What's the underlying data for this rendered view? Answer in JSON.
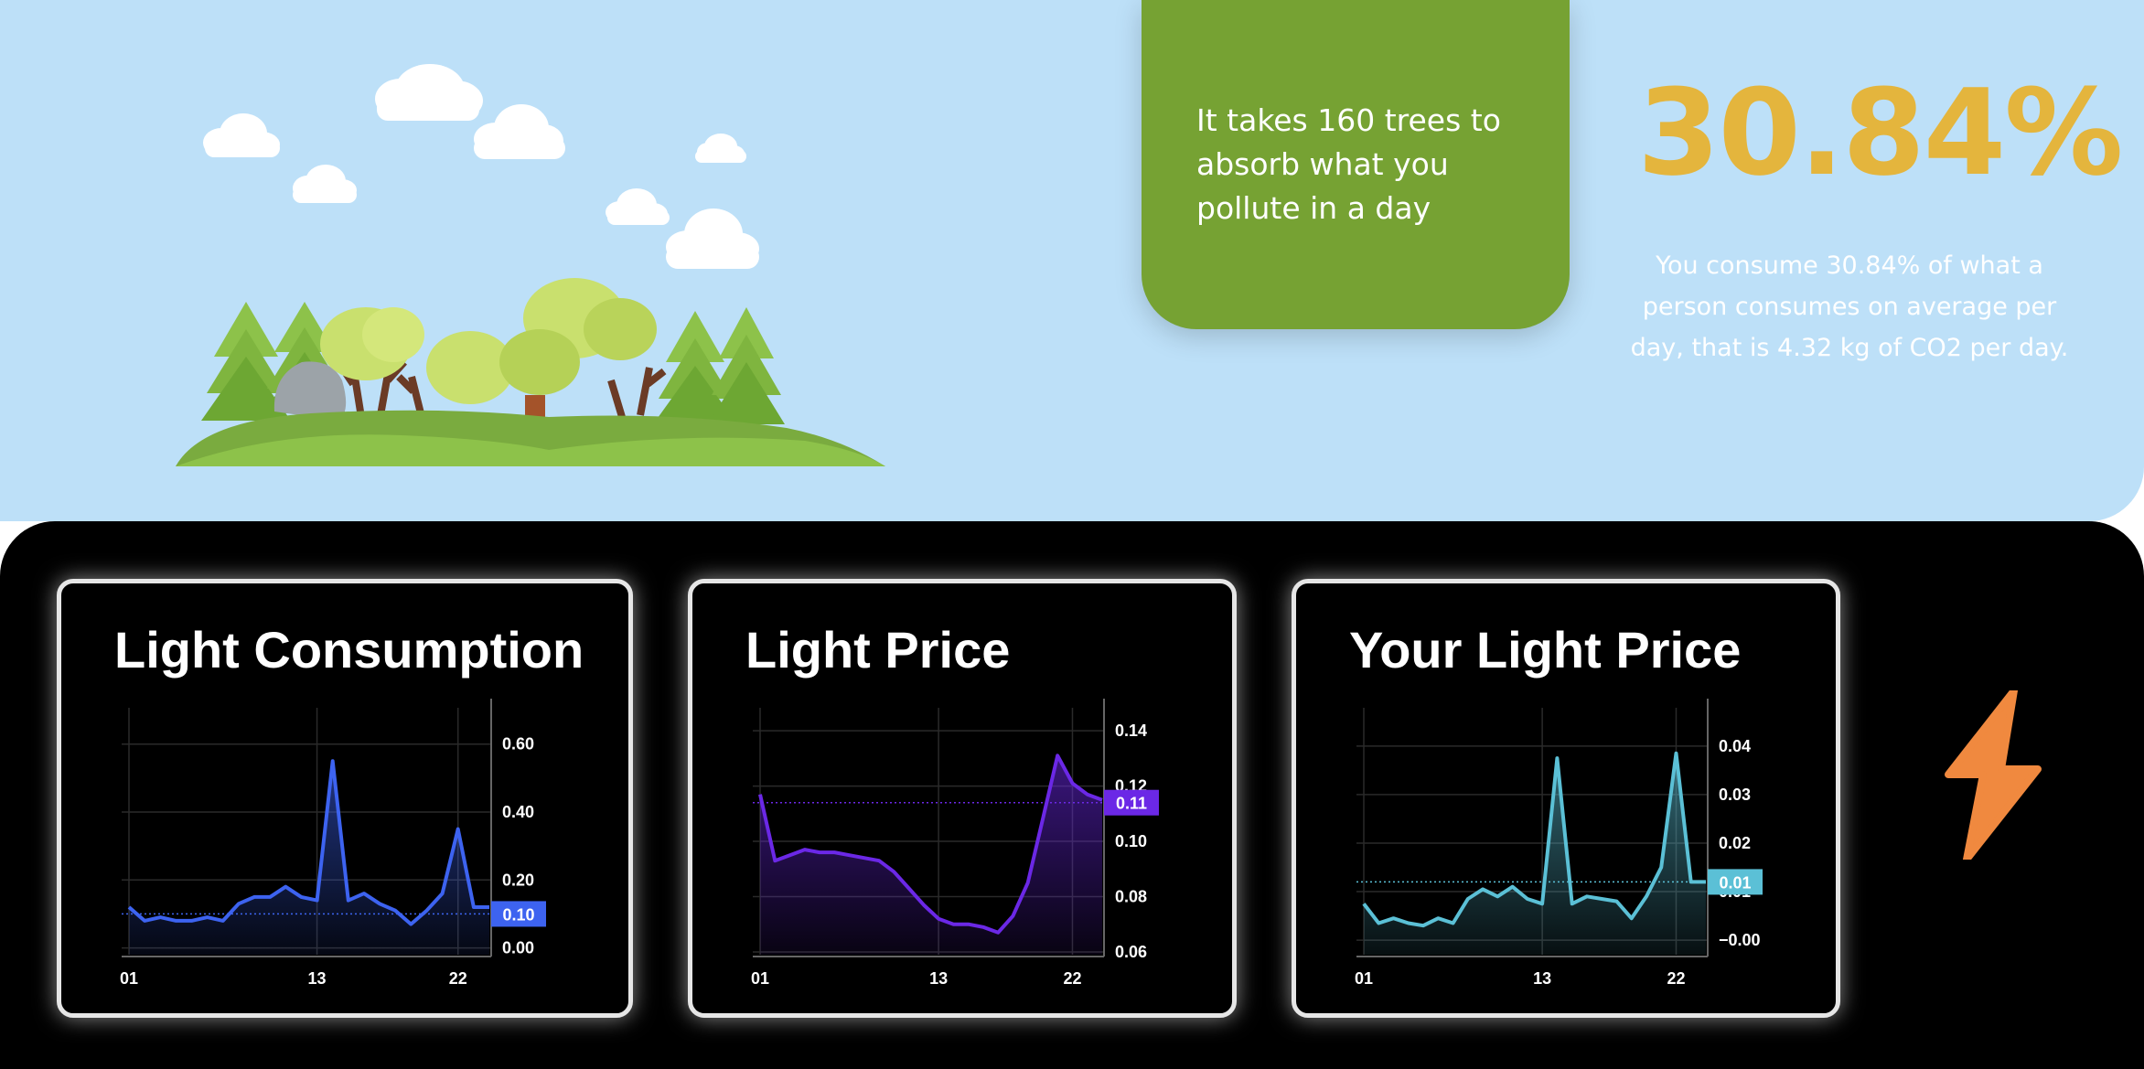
{
  "hero": {
    "tree_card_text": "It takes 160 trees to absorb what you pollute in a day",
    "percent": "30.84%",
    "consume_text": "You consume 30.84% of what a person consumes on average per day, that is 4.32 kg of CO2 per day."
  },
  "colors": {
    "sky": "#bde0f8",
    "tree_card": "#76a233",
    "percent": "#e4b53d",
    "bolt": "#f0893f"
  },
  "icons": {
    "bolt": "lightning-bolt-icon"
  },
  "chart_data": [
    {
      "type": "area",
      "title": "Light Consumption",
      "color": "#3d63f0",
      "x": [
        1,
        2,
        3,
        4,
        5,
        6,
        7,
        8,
        9,
        10,
        11,
        12,
        13,
        14,
        15,
        16,
        17,
        18,
        19,
        20,
        21,
        22,
        23,
        24
      ],
      "y": [
        0.12,
        0.08,
        0.09,
        0.08,
        0.08,
        0.09,
        0.08,
        0.13,
        0.15,
        0.15,
        0.18,
        0.15,
        0.14,
        0.55,
        0.14,
        0.16,
        0.13,
        0.11,
        0.07,
        0.11,
        0.16,
        0.35,
        0.12,
        0.12
      ],
      "ylim": [
        -0.02,
        0.68
      ],
      "yticks": [
        0.0,
        0.2,
        0.4,
        0.6
      ],
      "ytick_labels": [
        "0.00",
        "0.20",
        "0.40",
        "0.60"
      ],
      "xticks": [
        1,
        13,
        22
      ],
      "xtick_labels": [
        "01",
        "13",
        "22"
      ],
      "current_value": 0.1,
      "current_label": "0.10"
    },
    {
      "type": "area",
      "title": "Light Price",
      "color": "#6b28e6",
      "x": [
        1,
        2,
        3,
        4,
        5,
        6,
        7,
        8,
        9,
        10,
        11,
        12,
        13,
        14,
        15,
        16,
        17,
        18,
        19,
        20,
        21,
        22,
        23,
        24
      ],
      "y": [
        0.117,
        0.093,
        0.095,
        0.097,
        0.096,
        0.096,
        0.095,
        0.094,
        0.093,
        0.089,
        0.083,
        0.077,
        0.072,
        0.07,
        0.07,
        0.069,
        0.067,
        0.073,
        0.085,
        0.108,
        0.131,
        0.121,
        0.117,
        0.115
      ],
      "ylim": [
        0.059,
        0.145
      ],
      "yticks": [
        0.06,
        0.08,
        0.1,
        0.12,
        0.14
      ],
      "ytick_labels": [
        "0.06",
        "0.08",
        "0.10",
        "0.12",
        "0.14"
      ],
      "xticks": [
        1,
        13,
        22
      ],
      "xtick_labels": [
        "01",
        "13",
        "22"
      ],
      "current_value": 0.114,
      "current_label": "0.11"
    },
    {
      "type": "area",
      "title": "Your Light Price",
      "color": "#5bc0d6",
      "x": [
        1,
        2,
        3,
        4,
        5,
        6,
        7,
        8,
        9,
        10,
        11,
        12,
        13,
        14,
        15,
        16,
        17,
        18,
        19,
        20,
        21,
        22,
        23,
        24
      ],
      "y": [
        0.0075,
        0.0035,
        0.0045,
        0.0035,
        0.003,
        0.0045,
        0.0035,
        0.0085,
        0.0105,
        0.009,
        0.011,
        0.0085,
        0.0075,
        0.0375,
        0.0075,
        0.009,
        0.0085,
        0.008,
        0.0045,
        0.009,
        0.015,
        0.0385,
        0.012,
        0.012
      ],
      "ylim": [
        -0.003,
        0.046
      ],
      "yticks": [
        0.0,
        0.01,
        0.02,
        0.03,
        0.04
      ],
      "ytick_labels": [
        "−0.00",
        "0.01",
        "0.02",
        "0.03",
        "0.04"
      ],
      "xticks": [
        1,
        13,
        22
      ],
      "xtick_labels": [
        "01",
        "13",
        "22"
      ],
      "current_value": 0.012,
      "current_label": "0.01"
    }
  ]
}
